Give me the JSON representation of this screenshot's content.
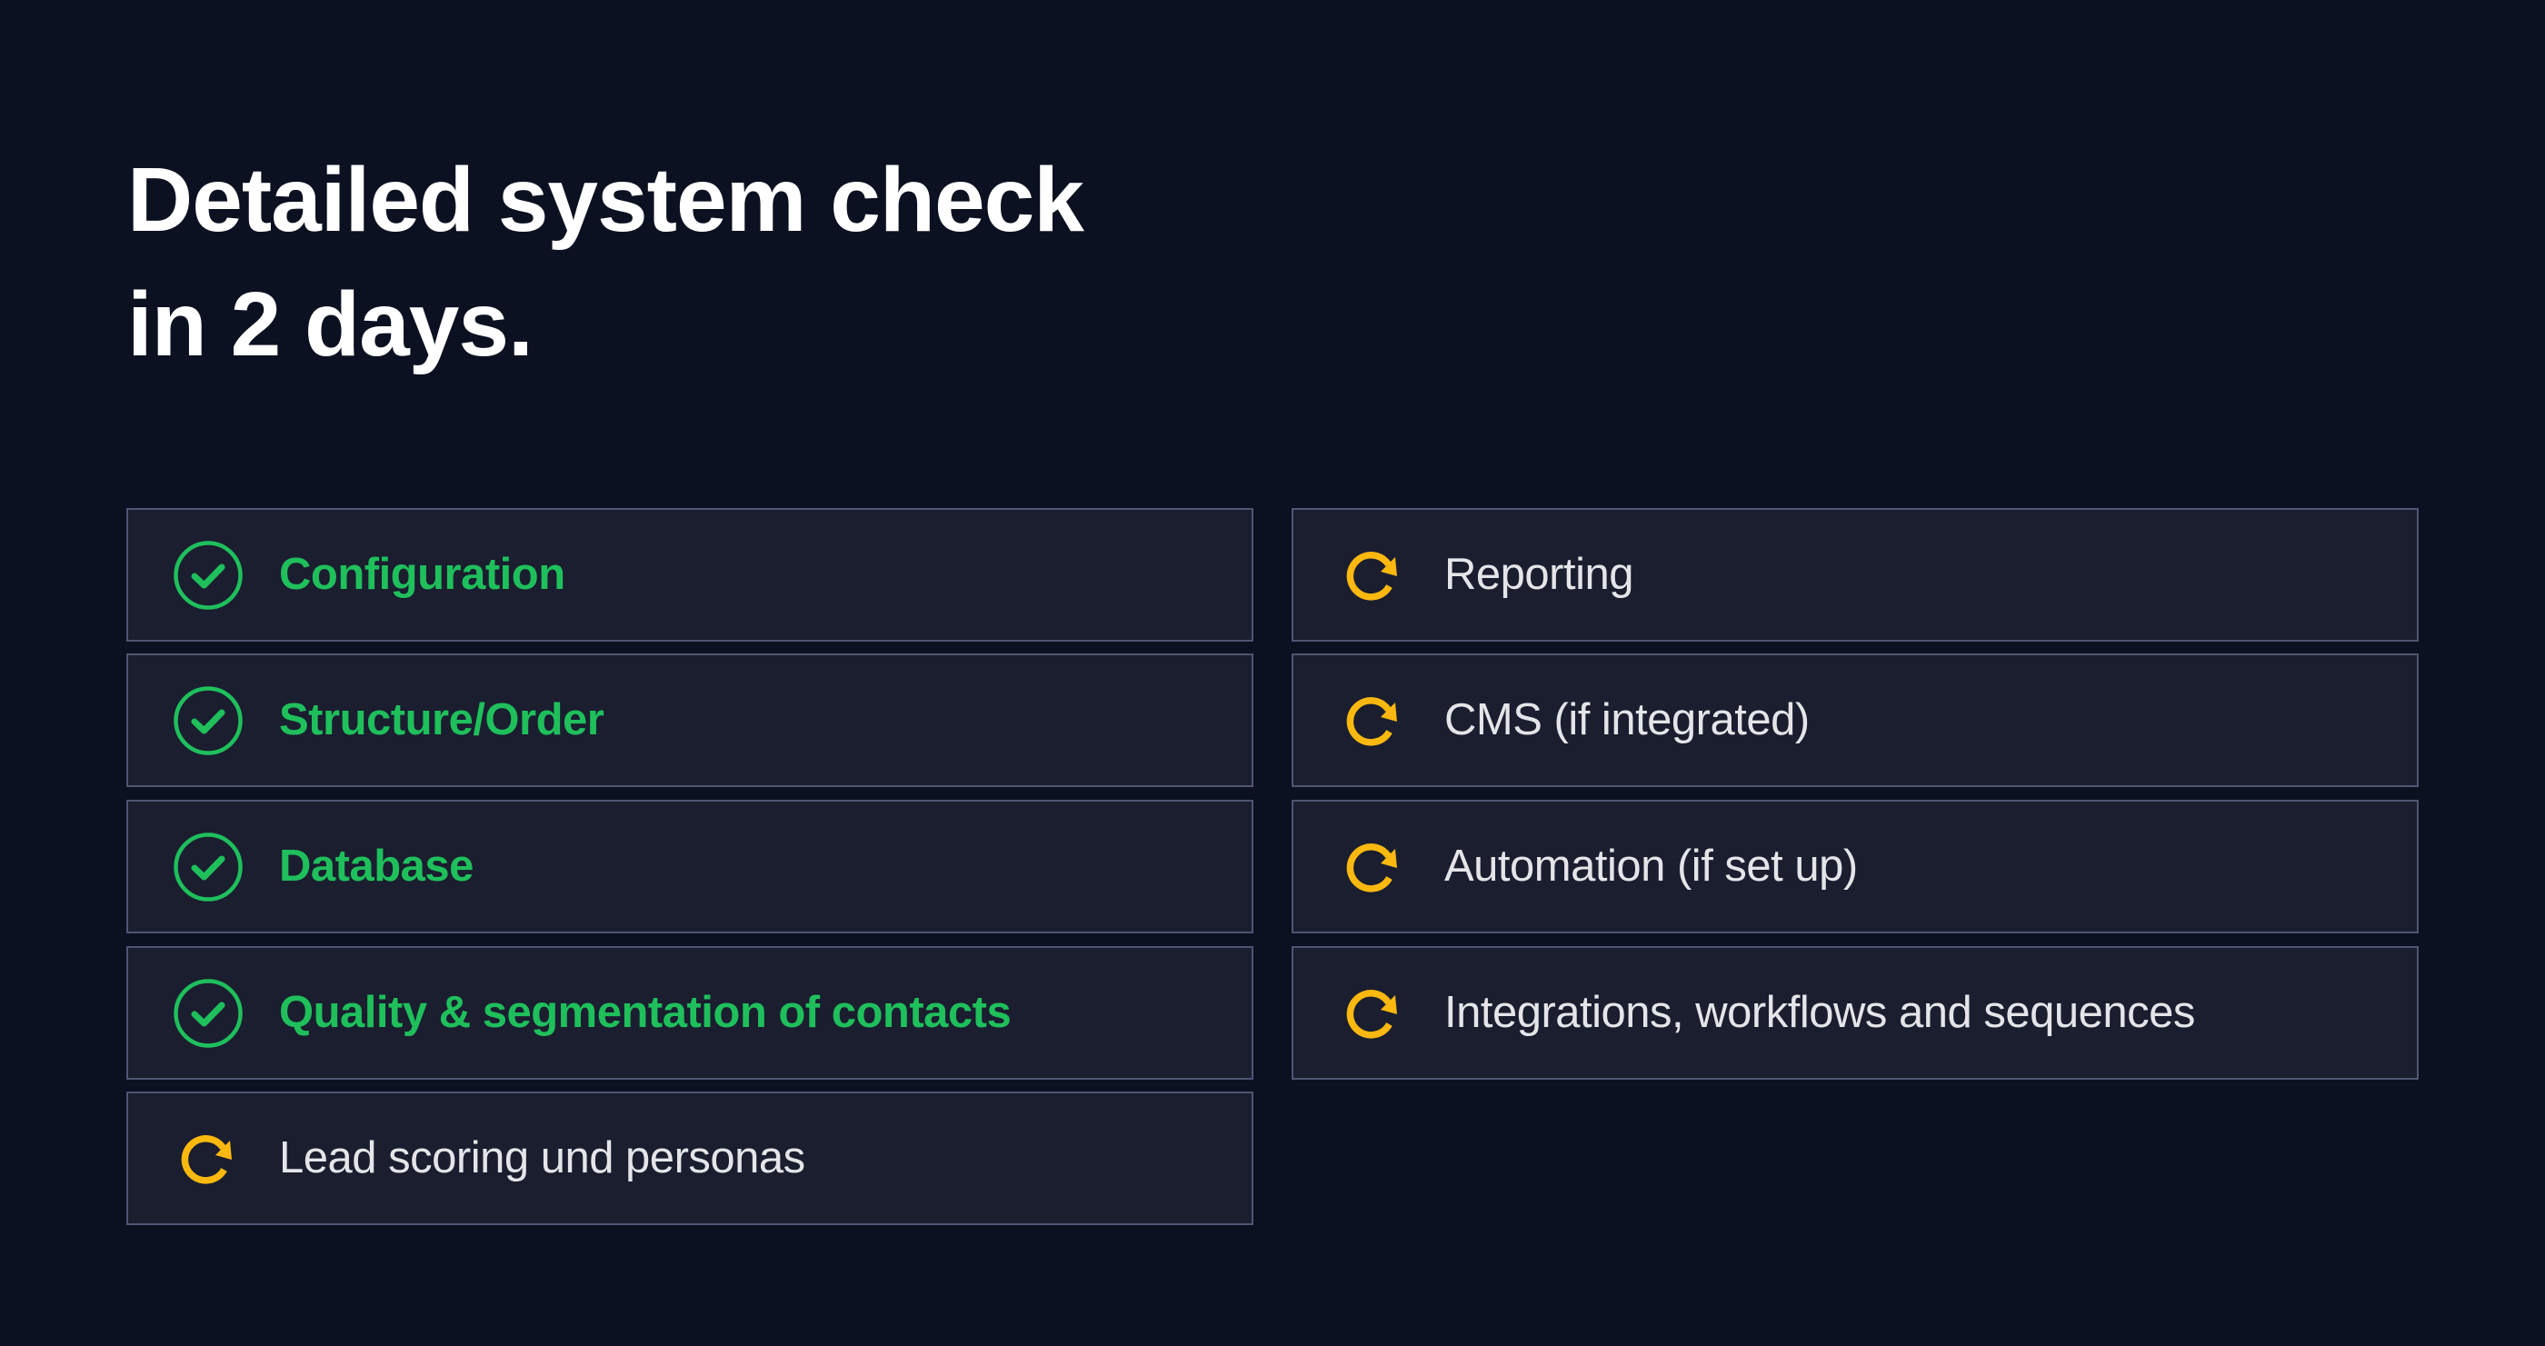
{
  "header": {
    "title_line1": "Detailed system check",
    "title_line2": "in 2 days."
  },
  "colors": {
    "background": "#0b1120",
    "card_background": "#1a1e2f",
    "card_border": "#4f5673",
    "done": "#1fbf5c",
    "pending": "#fbb80f",
    "title_text": "#ffffff",
    "pending_text": "#e4e5e9"
  },
  "checklist": {
    "left": [
      {
        "label": "Configuration",
        "status": "done",
        "icon": "check-circle-icon"
      },
      {
        "label": "Structure/Order",
        "status": "done",
        "icon": "check-circle-icon"
      },
      {
        "label": "Database",
        "status": "done",
        "icon": "check-circle-icon"
      },
      {
        "label": "Quality & segmentation of contacts",
        "status": "done",
        "icon": "check-circle-icon"
      },
      {
        "label": "Lead scoring und personas",
        "status": "pending",
        "icon": "refresh-icon"
      }
    ],
    "right": [
      {
        "label": "Reporting",
        "status": "pending",
        "icon": "refresh-icon"
      },
      {
        "label": "CMS (if integrated)",
        "status": "pending",
        "icon": "refresh-icon"
      },
      {
        "label": "Automation (if set up)",
        "status": "pending",
        "icon": "refresh-icon"
      },
      {
        "label": "Integrations, workflows and sequences",
        "status": "pending",
        "icon": "refresh-icon"
      }
    ]
  }
}
